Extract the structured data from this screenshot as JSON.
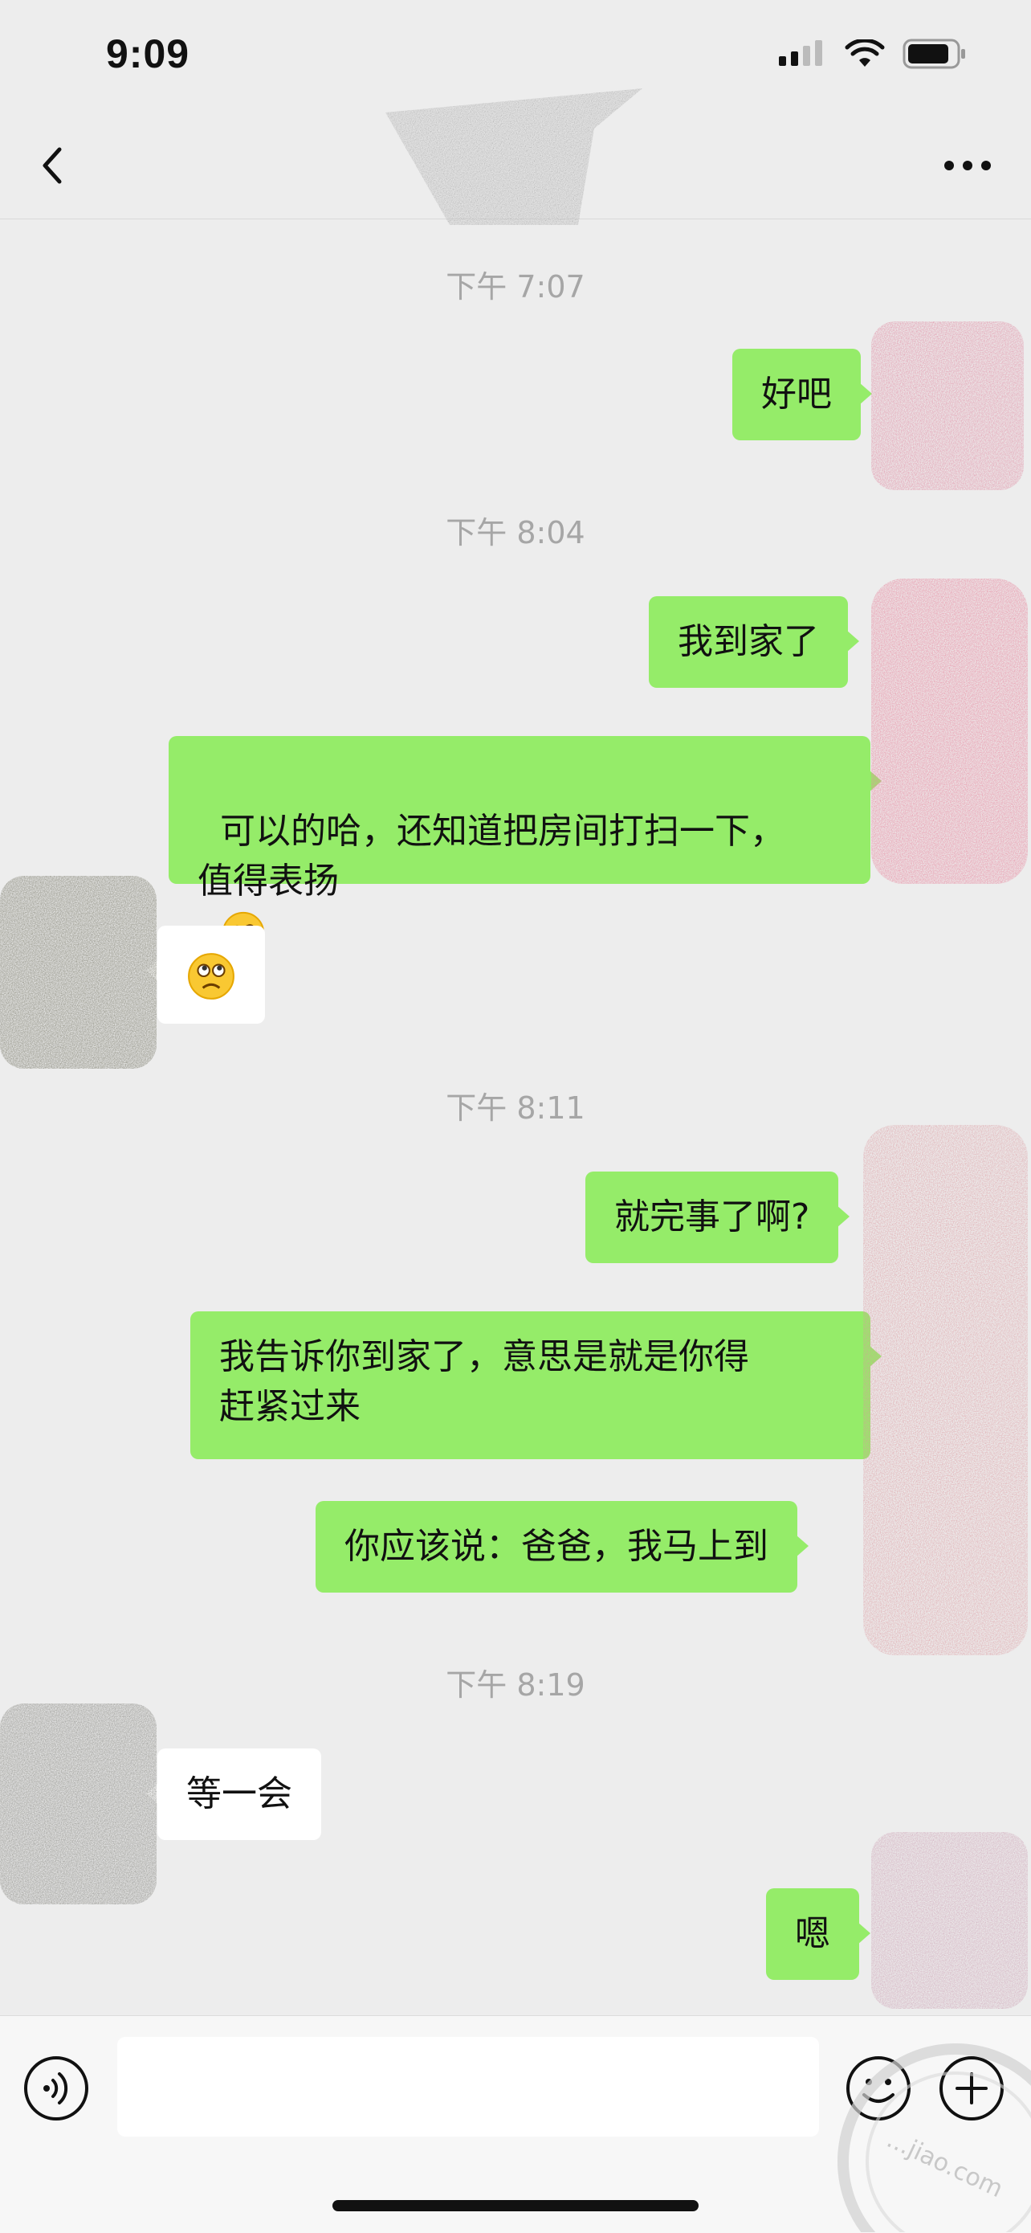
{
  "status_bar": {
    "time": "9:09"
  },
  "nav": {
    "back_icon": "chevron-left-icon",
    "more_icon": "ellipsis-icon"
  },
  "messages": {
    "ts1": "下午 7:07",
    "m1": "好吧",
    "ts2": "下午 8:04",
    "m2": "我到家了",
    "m3": "可以的哈，还知道把房间打扫一下，\n值得表扬",
    "ts3": "下午 8:11",
    "m5": "就完事了啊?",
    "m6": "我告诉你到家了，意思是就是你得\n赶紧过来",
    "m7": "你应该说：爸爸，我马上到",
    "ts4": "下午 8:19",
    "m8": "等一会",
    "m9": "嗯"
  },
  "input": {
    "placeholder": ""
  },
  "watermark": {
    "text": "...jiao.com"
  },
  "colors": {
    "outgoing": "#95ec69",
    "incoming": "#ffffff",
    "background": "#ededed"
  }
}
